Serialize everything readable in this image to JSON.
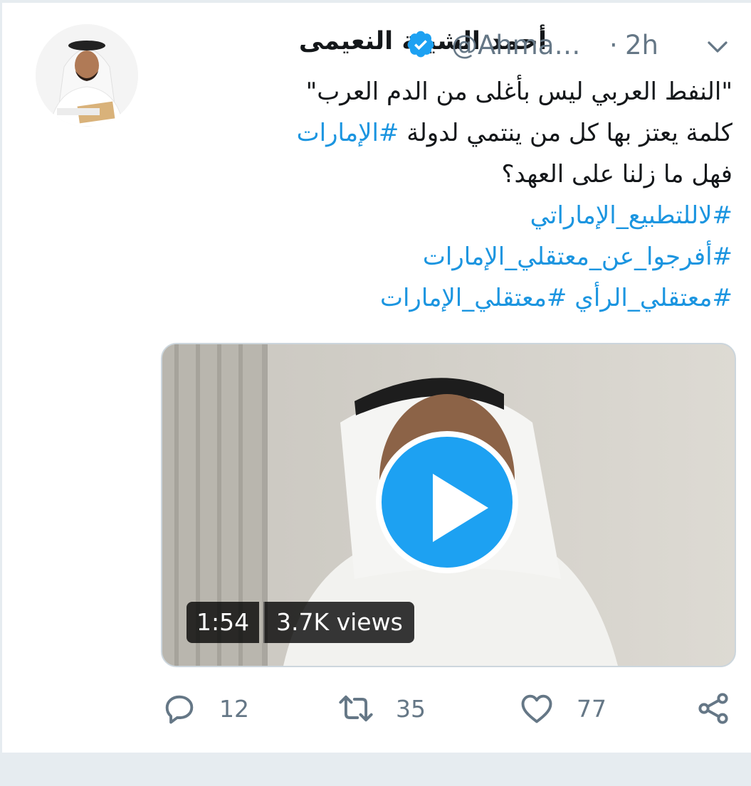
{
  "tweet": {
    "display_name": "أحمد الشيبة النعيمى",
    "handle": "@Ahma…",
    "separator": "·",
    "time": "2h",
    "lines": [
      {
        "plain": "\"النفط العربي ليس بأغلى من الدم العرب\"",
        "tag": ""
      },
      {
        "plain": "كلمة يعتز بها كل من ينتمي لدولة ",
        "tag": "#الإمارات"
      },
      {
        "plain": "فهل ما زلنا على العهد؟",
        "tag": ""
      }
    ],
    "hashtags": [
      "#لاللتطبيع_الإماراتي",
      "#أفرجوا_عن_معتقلي_الإمارات",
      "#معتقلي_الرأي #معتقلي_الإمارات"
    ]
  },
  "media": {
    "duration": "1:54",
    "views": "3.7K views"
  },
  "actions": {
    "reply_count": "12",
    "retweet_count": "35",
    "like_count": "77"
  },
  "colors": {
    "accent": "#1da1f2",
    "hashtag": "#1b95e0",
    "muted": "#657786",
    "text": "#14171a"
  },
  "icons": {
    "verified": "verified-badge-icon",
    "more": "chevron-down-icon",
    "reply": "reply-icon",
    "retweet": "retweet-icon",
    "like": "heart-icon",
    "share": "share-icon",
    "play": "play-icon"
  }
}
